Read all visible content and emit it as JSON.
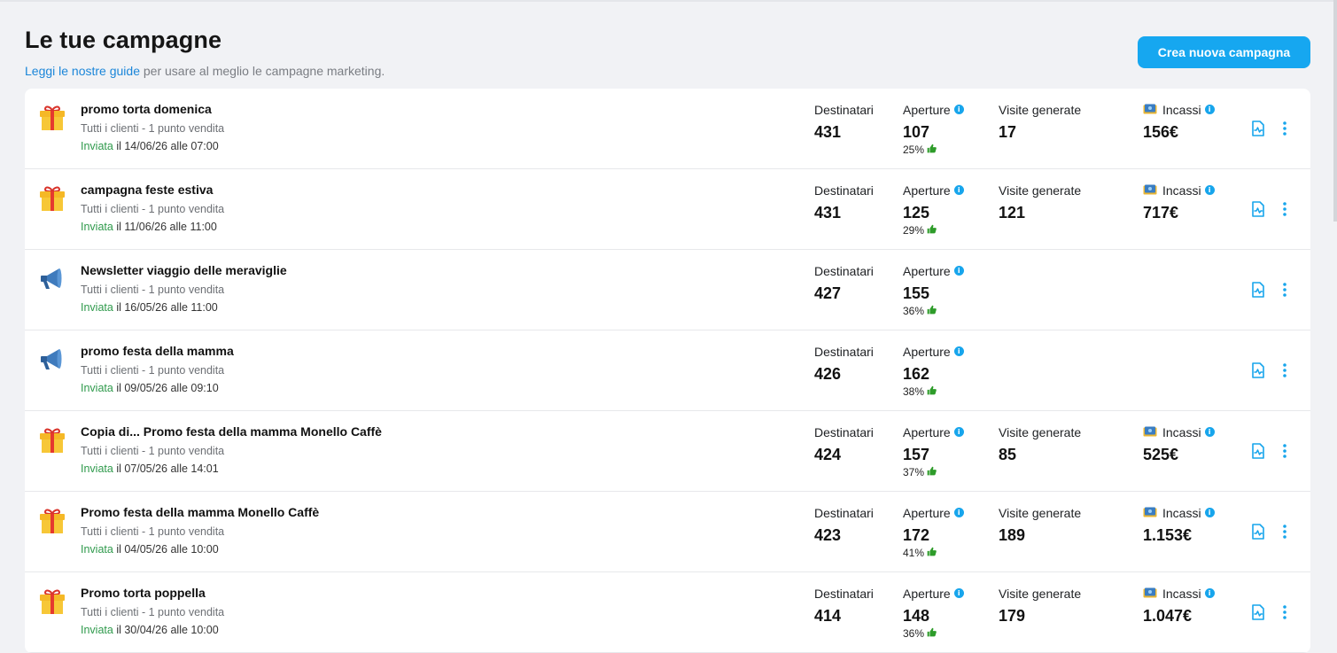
{
  "page": {
    "title": "Le tue campagne",
    "guide_link": "Leggi le nostre guide",
    "guide_rest": " per usare al meglio le campagne marketing.",
    "new_button": "Crea nuova campagna"
  },
  "labels": {
    "recipients": "Destinatari",
    "opens": "Aperture",
    "visits": "Visite generate",
    "revenue": "Incassi"
  },
  "colors": {
    "accent": "#16a7f0",
    "sent_status": "#2f9a4c",
    "link": "#1b86d9"
  },
  "campaigns": [
    {
      "icon": "gift-icon",
      "name": "promo torta domenica",
      "target": "Tutti i clienti - 1 punto vendita",
      "status": "Inviata",
      "date": " il 14/06/26 alle 07:00",
      "recipients": "431",
      "opens": "107",
      "open_pct": "25%",
      "visits": "17",
      "revenue": "156€"
    },
    {
      "icon": "gift-icon",
      "name": "campagna feste estiva",
      "target": "Tutti i clienti - 1 punto vendita",
      "status": "Inviata",
      "date": " il 11/06/26 alle 11:00",
      "recipients": "431",
      "opens": "125",
      "open_pct": "29%",
      "visits": "121",
      "revenue": "717€"
    },
    {
      "icon": "megaphone-icon",
      "name": "Newsletter viaggio delle meraviglie",
      "target": "Tutti i clienti - 1 punto vendita",
      "status": "Inviata",
      "date": " il 16/05/26 alle 11:00",
      "recipients": "427",
      "opens": "155",
      "open_pct": "36%"
    },
    {
      "icon": "megaphone-icon",
      "name": "promo festa della mamma",
      "target": "Tutti i clienti - 1 punto vendita",
      "status": "Inviata",
      "date": " il 09/05/26 alle 09:10",
      "recipients": "426",
      "opens": "162",
      "open_pct": "38%"
    },
    {
      "icon": "gift-icon",
      "name": "Copia di... Promo festa della mamma Monello Caffè",
      "target": "Tutti i clienti - 1 punto vendita",
      "status": "Inviata",
      "date": " il 07/05/26 alle 14:01",
      "recipients": "424",
      "opens": "157",
      "open_pct": "37%",
      "visits": "85",
      "revenue": "525€"
    },
    {
      "icon": "gift-icon",
      "name": "Promo festa della mamma Monello Caffè",
      "target": "Tutti i clienti - 1 punto vendita",
      "status": "Inviata",
      "date": " il 04/05/26 alle 10:00",
      "recipients": "423",
      "opens": "172",
      "open_pct": "41%",
      "visits": "189",
      "revenue": "1.153€"
    },
    {
      "icon": "gift-icon",
      "name": "Promo torta poppella",
      "target": "Tutti i clienti - 1 punto vendita",
      "status": "Inviata",
      "date": " il 30/04/26 alle 10:00",
      "recipients": "414",
      "opens": "148",
      "open_pct": "36%",
      "visits": "179",
      "revenue": "1.047€"
    }
  ]
}
